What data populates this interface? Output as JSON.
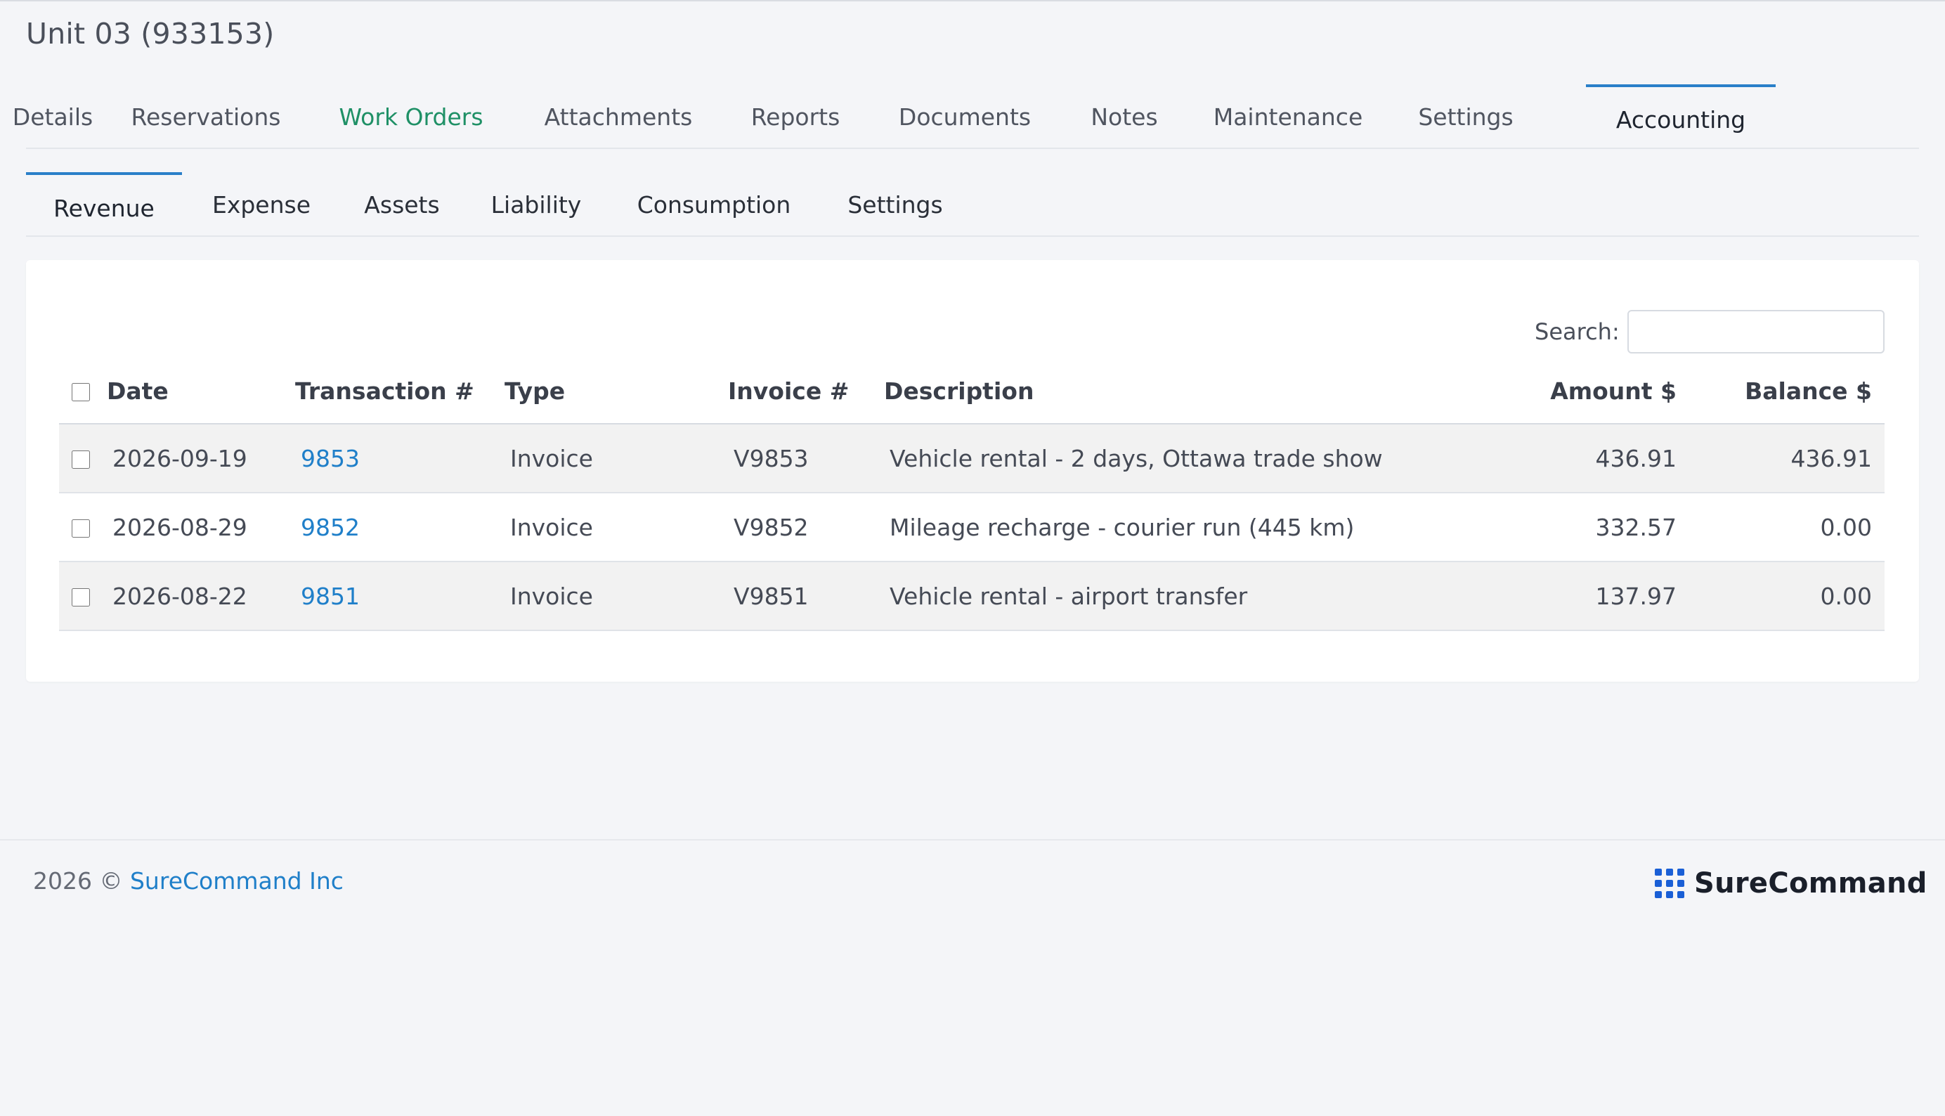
{
  "page": {
    "title": "Unit 03 (933153)"
  },
  "main_tabs": [
    {
      "label": "Details"
    },
    {
      "label": "Reservations"
    },
    {
      "label": "Work Orders"
    },
    {
      "label": "Attachments"
    },
    {
      "label": "Reports"
    },
    {
      "label": "Documents"
    },
    {
      "label": "Notes"
    },
    {
      "label": "Maintenance"
    },
    {
      "label": "Settings"
    },
    {
      "label": "Accounting"
    }
  ],
  "sub_tabs": [
    {
      "label": "Revenue"
    },
    {
      "label": "Expense"
    },
    {
      "label": "Assets"
    },
    {
      "label": "Liability"
    },
    {
      "label": "Consumption"
    },
    {
      "label": "Settings"
    }
  ],
  "search": {
    "label": "Search:",
    "value": "",
    "placeholder": ""
  },
  "table": {
    "headers": {
      "date": "Date",
      "transaction": "Transaction #",
      "type": "Type",
      "invoice": "Invoice #",
      "description": "Description",
      "amount": "Amount $",
      "balance": "Balance $"
    },
    "rows": [
      {
        "date": "2026-09-19",
        "transaction": "9853",
        "type": "Invoice",
        "invoice": "V9853",
        "description": "Vehicle rental - 2 days, Ottawa trade show",
        "amount": "436.91",
        "balance": "436.91"
      },
      {
        "date": "2026-08-29",
        "transaction": "9852",
        "type": "Invoice",
        "invoice": "V9852",
        "description": "Mileage recharge - courier run (445 km)",
        "amount": "332.57",
        "balance": "0.00"
      },
      {
        "date": "2026-08-22",
        "transaction": "9851",
        "type": "Invoice",
        "invoice": "V9851",
        "description": "Vehicle rental - airport transfer",
        "amount": "137.97",
        "balance": "0.00"
      }
    ]
  },
  "footer": {
    "copyright": "2026 ©",
    "company_link": "SureCommand Inc",
    "brand": "SureCommand"
  },
  "colors": {
    "link": "#1f7fc9",
    "highlight_tab": "#1f9066",
    "active_underline": "#2a7fc9",
    "brand_blue": "#1a5fd6"
  }
}
